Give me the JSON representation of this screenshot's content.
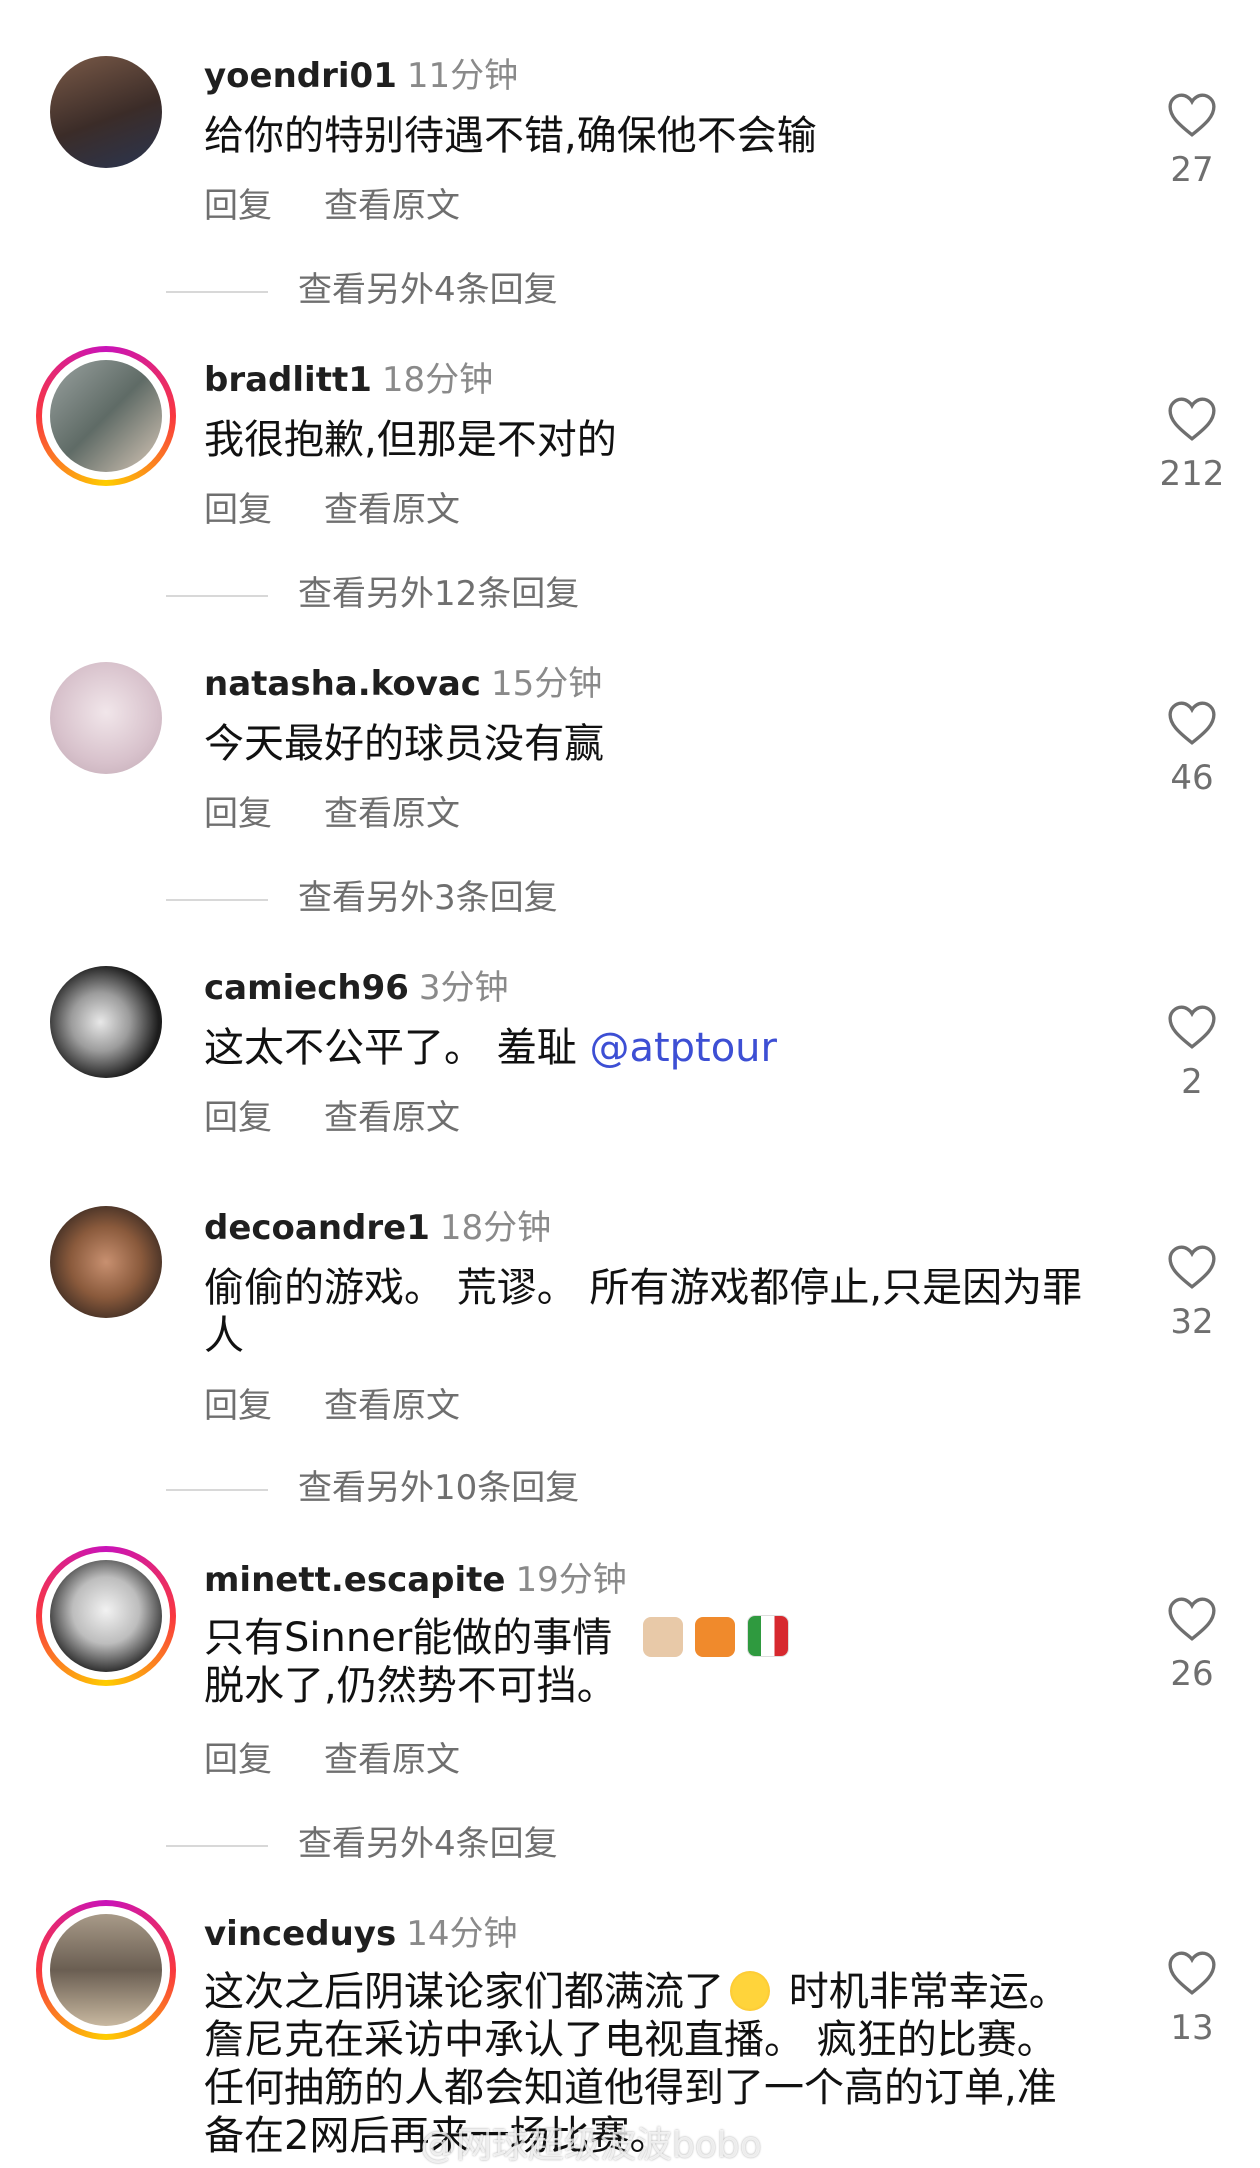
{
  "comments": [
    {
      "username": "yoendri01",
      "time": "11分钟",
      "text": "给你的特别待遇不错,确保他不会输",
      "reply": "回复",
      "translate": "查看原文",
      "likes": "27",
      "more": "查看另外4条回复"
    },
    {
      "username": "bradlitt1",
      "time": "18分钟",
      "text": "我很抱歉,但那是不对的",
      "reply": "回复",
      "translate": "查看原文",
      "likes": "212",
      "more": "查看另外12条回复"
    },
    {
      "username": "natasha.kovac",
      "time": "15分钟",
      "text": "今天最好的球员没有赢",
      "reply": "回复",
      "translate": "查看原文",
      "likes": "46",
      "more": "查看另外3条回复"
    },
    {
      "username": "camiech96",
      "time": "3分钟",
      "text": "这太不公平了。 羞耻 ",
      "mention": "@atptour",
      "reply": "回复",
      "translate": "查看原文",
      "likes": "2"
    },
    {
      "username": "decoandre1",
      "time": "18分钟",
      "text": "偷偷的游戏。 荒谬。 所有游戏都停止,只是因为罪人",
      "reply": "回复",
      "translate": "查看原文",
      "likes": "32",
      "more": "查看另外10条回复"
    },
    {
      "username": "minett.escapite",
      "time": "19分钟",
      "text_line1": "只有Sinner能做的事情",
      "text_line2": "脱水了,仍然势不可挡。",
      "emojis": [
        "rock-hand-emoji",
        "fox-emoji",
        "italy-flag-emoji"
      ],
      "reply": "回复",
      "translate": "查看原文",
      "likes": "26",
      "more": "查看另外4条回复"
    },
    {
      "username": "vinceduys",
      "time": "14分钟",
      "text_part1": "这次之后阴谋论家们都满流了",
      "emoji": "laughing-tears-emoji",
      "text_part2": " 时机非常幸运。 詹尼克在采访中承认了电视直播。 疯狂的比赛。 任何抽筋的人都会知道他得到了一个高的订单,准备在2网后再来一场比赛。",
      "likes": "13"
    }
  ],
  "watermark": "@网球超级波波bobo",
  "colors": {
    "mention": "#3d4fd4",
    "story_ring": [
      "#c913b9",
      "#f9373f",
      "#fecd00"
    ]
  }
}
